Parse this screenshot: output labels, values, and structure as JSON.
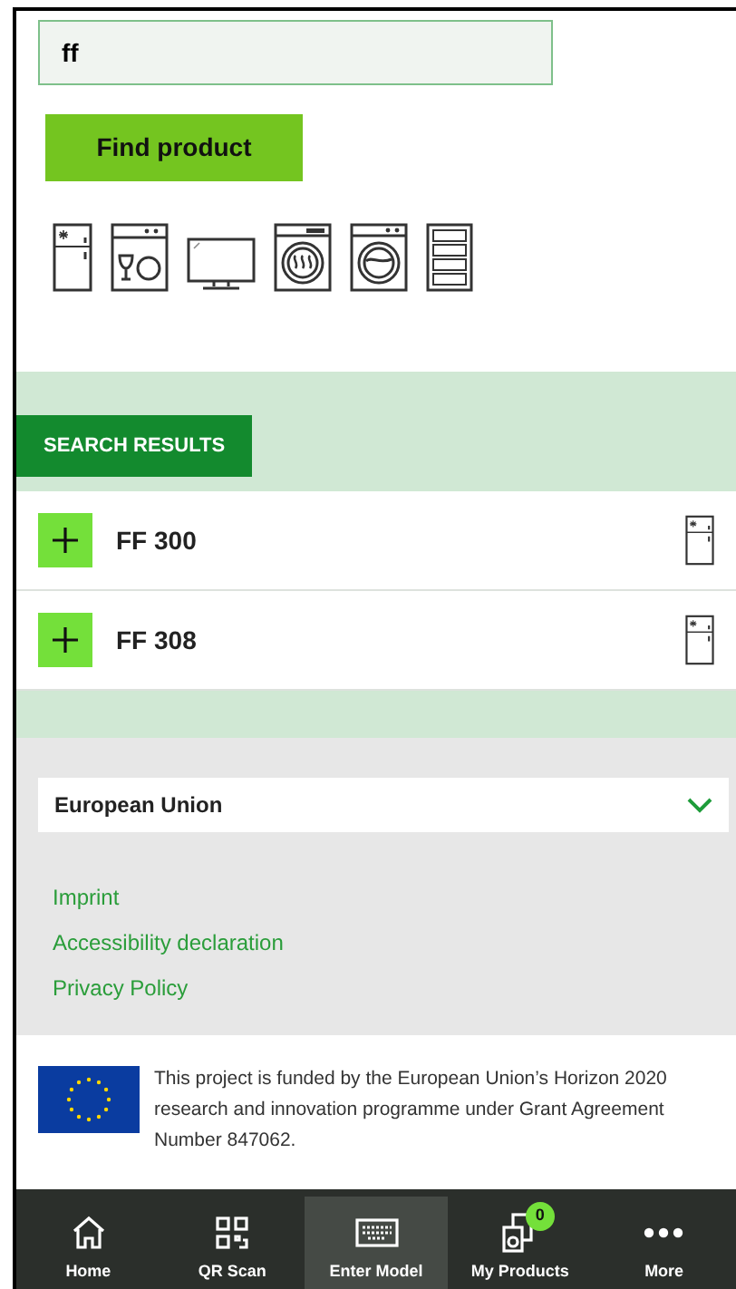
{
  "search": {
    "value": "ff"
  },
  "find_button": "Find product",
  "categories": [
    {
      "kind": "fridge"
    },
    {
      "kind": "dishwasher"
    },
    {
      "kind": "tv"
    },
    {
      "kind": "dryer"
    },
    {
      "kind": "washer"
    },
    {
      "kind": "wine"
    }
  ],
  "results_title": "SEARCH RESULTS",
  "results": [
    {
      "model": "FF 300",
      "kind": "fridge"
    },
    {
      "model": "FF 308",
      "kind": "fridge"
    }
  ],
  "region": {
    "value": "European Union"
  },
  "links": [
    "Imprint",
    "Accessibility declaration",
    "Privacy Policy"
  ],
  "funding": "This project is funded by the European Union’s Horizon 2020 research and innovation programme under Grant Agreement Number 847062.",
  "nav": [
    {
      "label": "Home",
      "kind": "home",
      "selected": false
    },
    {
      "label": "QR Scan",
      "kind": "qr",
      "selected": false
    },
    {
      "label": "Enter Model",
      "kind": "keyboard",
      "selected": true
    },
    {
      "label": "My Products",
      "kind": "products",
      "selected": false,
      "badge": "0"
    },
    {
      "label": "More",
      "kind": "more",
      "selected": false
    }
  ]
}
